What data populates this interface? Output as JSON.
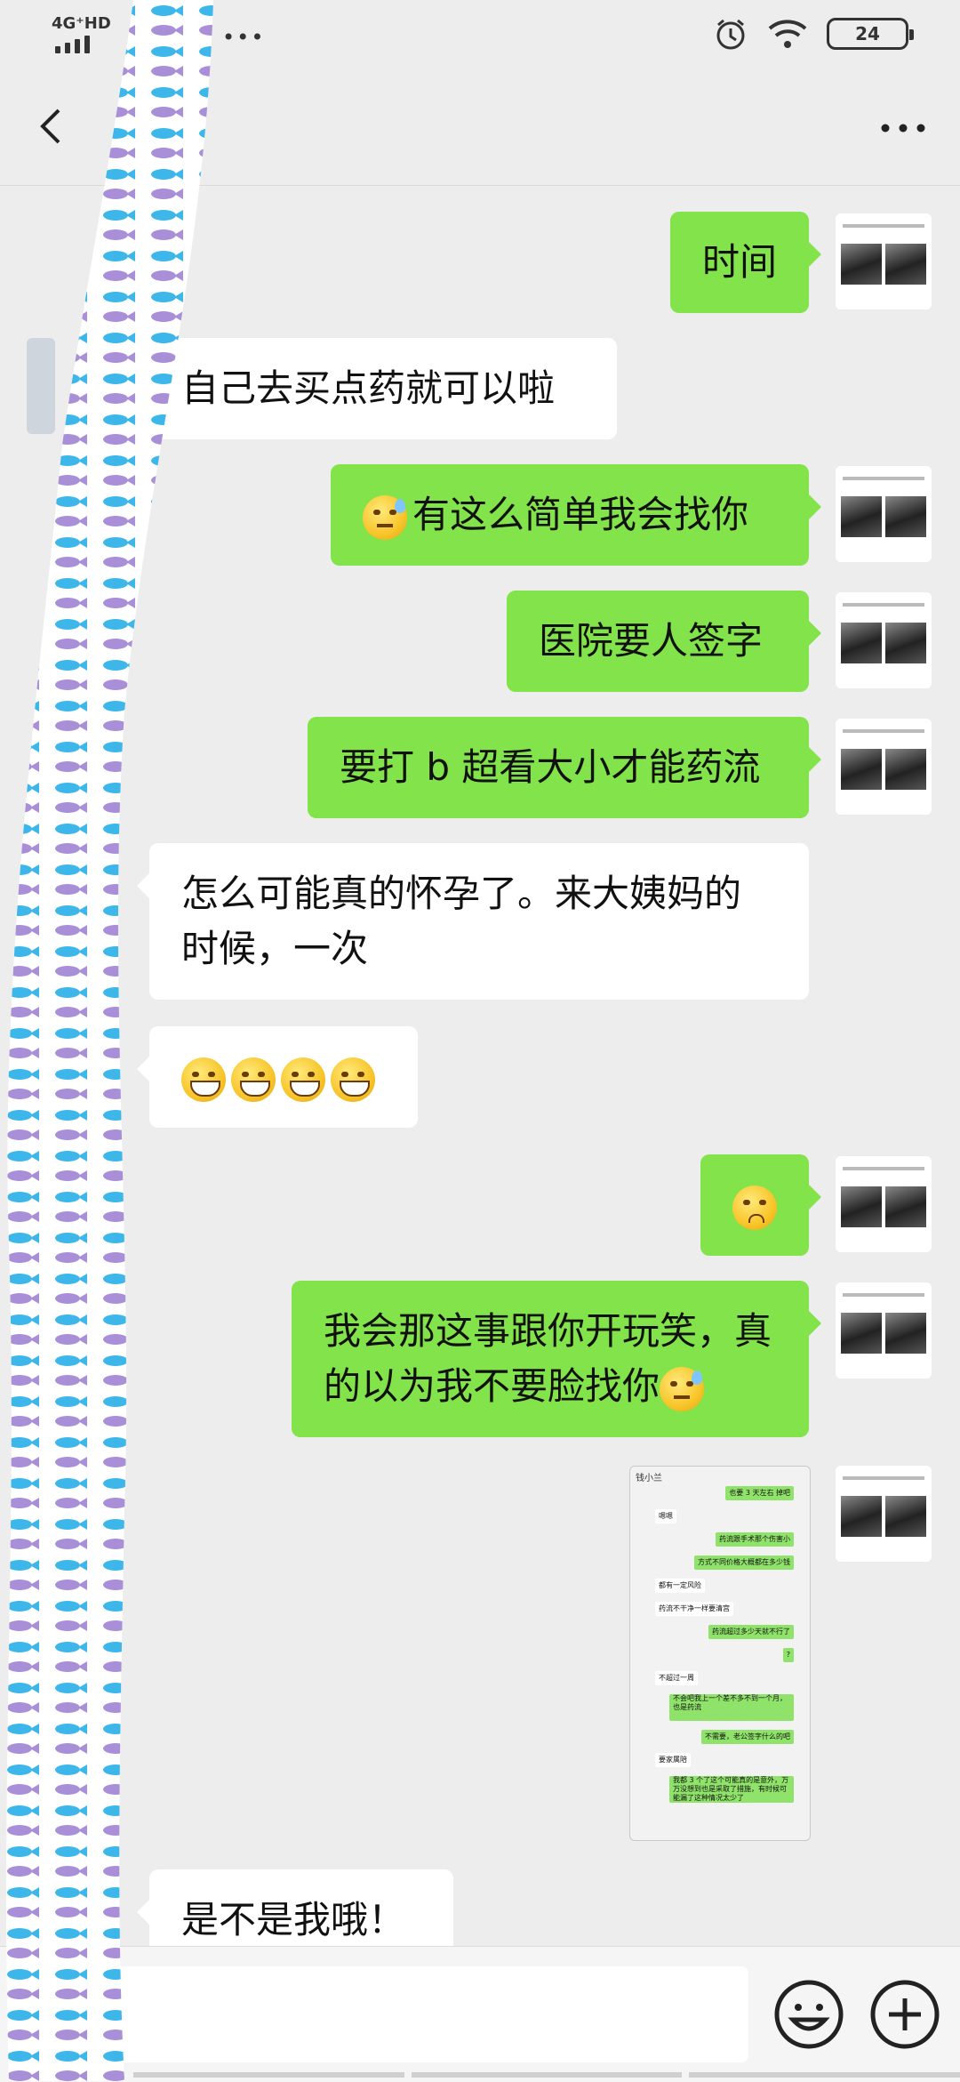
{
  "status_bar": {
    "network": "4G⁺HD",
    "battery": "24"
  },
  "messages": [
    {
      "side": "me",
      "text": "时间"
    },
    {
      "side": "other",
      "text": "自己去买点药就可以啦"
    },
    {
      "side": "me",
      "emoji": "sweat-smile-emoji",
      "text": "有这么简单我会找你"
    },
    {
      "side": "me",
      "text": "医院要人签字"
    },
    {
      "side": "me",
      "text": "要打 b 超看大小才能药流"
    },
    {
      "side": "other",
      "text": "怎么可能真的怀孕了。来大姨妈的时候，一次"
    },
    {
      "side": "other",
      "emojis": [
        "grin-emoji",
        "grin-emoji",
        "grin-emoji",
        "grin-emoji"
      ]
    },
    {
      "side": "me",
      "emoji": "pleading-emoji"
    },
    {
      "side": "me",
      "text": "我会那这事跟你开玩笑，真的以为我不要脸找你",
      "emoji_after": "sweat-smile-emoji"
    },
    {
      "side": "me",
      "type": "image",
      "title": "钱小兰"
    },
    {
      "side": "other",
      "text": "是不是我哦！"
    }
  ],
  "screenshot_lines": [
    {
      "s": "g",
      "t": "也要 3 天左右 掉吧"
    },
    {
      "s": "w",
      "t": "嗯嗯"
    },
    {
      "s": "g",
      "t": "药流跟手术那个伤害小"
    },
    {
      "s": "g",
      "t": "方式不同价格大概都在多少钱"
    },
    {
      "s": "w",
      "t": "都有一定风险"
    },
    {
      "s": "w",
      "t": "药流不干净一样要清宫"
    },
    {
      "s": "g",
      "t": "药流超过多少天就不行了"
    },
    {
      "s": "g",
      "t": "?"
    },
    {
      "s": "w",
      "t": "不超过一周"
    },
    {
      "s": "g",
      "t": "不会吧我上一个差不多不到一个月，也是药流"
    },
    {
      "s": "g",
      "t": "不需要，老公签字什么的吧"
    },
    {
      "s": "w",
      "t": "要家属陪"
    },
    {
      "s": "g",
      "t": "我都 3 个了这个可能真的是意外，万万没想到也是采取了措施，有时候可能漏了这种情况太少了"
    }
  ],
  "colors": {
    "my_bubble": "#82e34a",
    "other_bubble": "#ffffff",
    "background": "#ededed"
  }
}
